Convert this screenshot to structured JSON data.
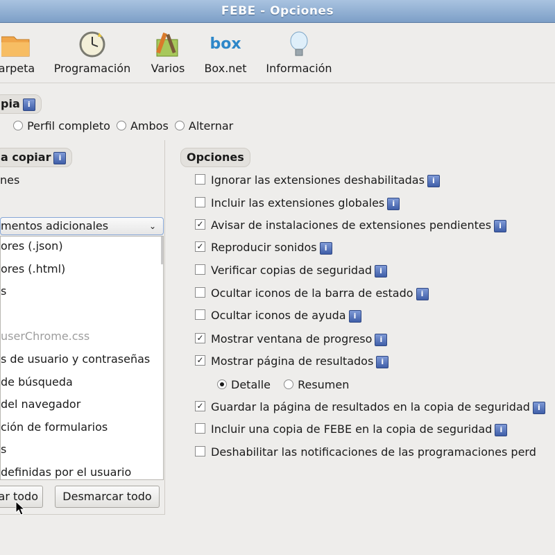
{
  "window": {
    "title": "FEBE - Opciones"
  },
  "toolbar": {
    "items": [
      {
        "label": "arpeta",
        "icon": "folder-icon"
      },
      {
        "label": "Programación",
        "icon": "clock-icon"
      },
      {
        "label": "Varios",
        "icon": "tools-icon"
      },
      {
        "label": "Box.net",
        "icon": "box-logo-icon",
        "logo_text": "box"
      },
      {
        "label": "Información",
        "icon": "lightbulb-icon"
      }
    ]
  },
  "backup_type": {
    "title": "pia",
    "options": [
      {
        "label": "Perfil completo",
        "selected": false
      },
      {
        "label": "Ambos",
        "selected": false
      },
      {
        "label": "Alternar",
        "selected": false
      }
    ]
  },
  "what_to_copy": {
    "title": "a copiar",
    "item_partial": "nes",
    "select_value": "mentos adicionales",
    "list_items": [
      {
        "label": "ores (.json)",
        "dim": false
      },
      {
        "label": "ores (.html)",
        "dim": false
      },
      {
        "label": "s",
        "dim": false
      },
      {
        "label": "",
        "dim": false
      },
      {
        "label": "userChrome.css",
        "dim": true
      },
      {
        "label": "s de usuario y contraseñas",
        "dim": false
      },
      {
        "label": "de búsqueda",
        "dim": false
      },
      {
        "label": "del navegador",
        "dim": false
      },
      {
        "label": "ción de formularios",
        "dim": false
      },
      {
        "label": "s",
        "dim": false
      },
      {
        "label": "definidas por el usuario",
        "dim": false
      }
    ],
    "select_all_label": "ar todo",
    "deselect_all_label": "Desmarcar todo"
  },
  "options": {
    "title": "Opciones",
    "items": [
      {
        "label": "Ignorar las extensiones deshabilitadas",
        "checked": false,
        "info": true
      },
      {
        "label": "Incluir las extensiones globales",
        "checked": false,
        "info": true
      },
      {
        "label": "Avisar de instalaciones de extensiones pendientes",
        "checked": true,
        "info": true
      },
      {
        "label": "Reproducir sonidos",
        "checked": true,
        "info": true
      },
      {
        "label": "Verificar copias de seguridad",
        "checked": false,
        "info": true
      },
      {
        "label": "Ocultar iconos de la barra de estado",
        "checked": false,
        "info": true
      },
      {
        "label": "Ocultar iconos de ayuda",
        "checked": false,
        "info": true
      },
      {
        "label": "Mostrar ventana de progreso",
        "checked": true,
        "info": true
      },
      {
        "label": "Mostrar página de resultados",
        "checked": true,
        "info": true
      },
      {
        "label": "Guardar la página de resultados en la copia de seguridad",
        "checked": true,
        "info": true
      },
      {
        "label": "Incluir una copia de FEBE en la copia de seguridad",
        "checked": false,
        "info": true
      },
      {
        "label": "Deshabilitar las notificaciones de las programaciones perd",
        "checked": false,
        "info": false
      }
    ],
    "results_mode": [
      {
        "label": "Detalle",
        "selected": true
      },
      {
        "label": "Resumen",
        "selected": false
      }
    ]
  },
  "info_glyph": "i",
  "colors": {
    "titlebar": "#8fb0d8",
    "info_icon": "#4a68b4"
  }
}
